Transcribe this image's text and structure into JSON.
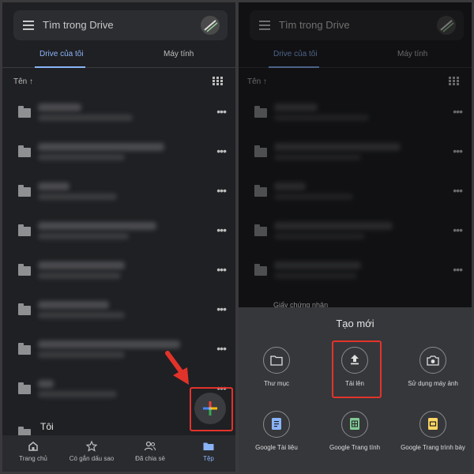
{
  "search": {
    "placeholder_text": "Tìm trong Drive"
  },
  "tabs": {
    "my_drive": "Drive của tôi",
    "computers": "Máy tính"
  },
  "sort": {
    "label": "Tên ↑"
  },
  "folders": {
    "last_name": "Tôi"
  },
  "bottom_nav": [
    {
      "label": "Trang chủ",
      "icon": "home-icon"
    },
    {
      "label": "Có gắn dấu sao",
      "icon": "star-icon"
    },
    {
      "label": "Đã chia sẻ",
      "icon": "people-icon"
    },
    {
      "label": "Tệp",
      "icon": "folder-icon"
    }
  ],
  "sheet": {
    "title": "Tạo mới",
    "peek_text": "Giấy chứng nhận",
    "options": [
      {
        "label": "Thư mục",
        "icon": "folder-icon"
      },
      {
        "label": "Tải lên",
        "icon": "upload-icon"
      },
      {
        "label": "Sử dụng máy ảnh",
        "icon": "camera-icon"
      },
      {
        "label": "Google Tài liệu",
        "icon": "google-docs-icon"
      },
      {
        "label": "Google Trang tính",
        "icon": "google-sheets-icon"
      },
      {
        "label": "Google Trang trình bày",
        "icon": "google-slides-icon"
      }
    ]
  },
  "colors": {
    "accent": "#8ab4f8",
    "background": "#1f2023",
    "highlight": "#e2332a",
    "docs": "#8ab4f8",
    "sheets": "#81c995",
    "slides": "#fdd663"
  }
}
